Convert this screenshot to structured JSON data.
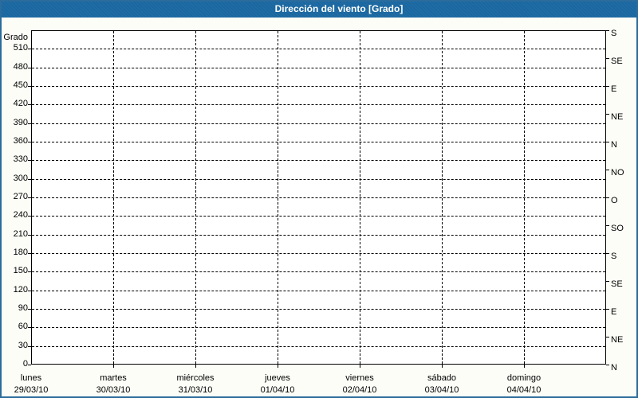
{
  "window": {
    "title": "Dirección del viento [Grado]"
  },
  "colors": {
    "titlebar_bg": "#1e6ca6",
    "titlebar_text": "#ffffff",
    "frame_border": "#2c6c9c",
    "page_bg": "#fdfdf8",
    "plot_bg": "#ffffff",
    "grid_line": "#000000",
    "label_text": "#000000"
  },
  "chart_data": {
    "type": "line",
    "title": "Dirección del viento [Grado]",
    "ylabel": "Grado",
    "ylim": [
      0,
      540
    ],
    "y_tick_interval_left": 30,
    "y_ticks_left": [
      0,
      30,
      60,
      90,
      120,
      150,
      180,
      210,
      240,
      270,
      300,
      330,
      360,
      390,
      420,
      450,
      480,
      510
    ],
    "y_ticks_right": [
      {
        "deg": 0,
        "label": "N"
      },
      {
        "deg": 45,
        "label": "NE"
      },
      {
        "deg": 90,
        "label": "E"
      },
      {
        "deg": 135,
        "label": "SE"
      },
      {
        "deg": 180,
        "label": "S"
      },
      {
        "deg": 225,
        "label": "SO"
      },
      {
        "deg": 270,
        "label": "O"
      },
      {
        "deg": 315,
        "label": "NO"
      },
      {
        "deg": 360,
        "label": "N"
      },
      {
        "deg": 405,
        "label": "NE"
      },
      {
        "deg": 450,
        "label": "E"
      },
      {
        "deg": 495,
        "label": "SE"
      },
      {
        "deg": 540,
        "label": "S"
      }
    ],
    "x_categories": [
      {
        "day": "lunes",
        "date": "29/03/10"
      },
      {
        "day": "martes",
        "date": "30/03/10"
      },
      {
        "day": "miércoles",
        "date": "31/03/10"
      },
      {
        "day": "jueves",
        "date": "01/04/10"
      },
      {
        "day": "viernes",
        "date": "02/04/10"
      },
      {
        "day": "sábado",
        "date": "03/04/10"
      },
      {
        "day": "domingo",
        "date": "04/04/10"
      }
    ],
    "series": [],
    "grid": "dashed",
    "legend": "none"
  }
}
